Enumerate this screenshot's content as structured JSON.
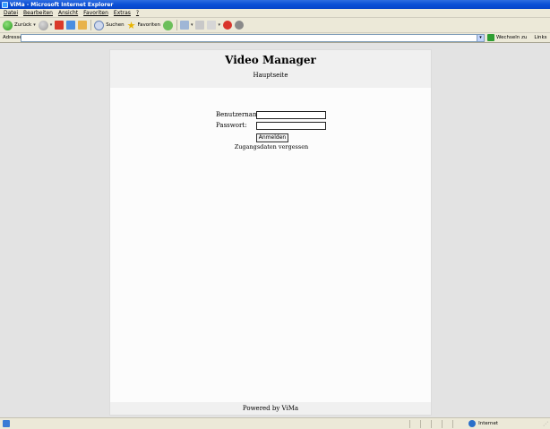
{
  "window": {
    "title": "ViMa - Microsoft Internet Explorer"
  },
  "menu": [
    "Datei",
    "Bearbeiten",
    "Ansicht",
    "Favoriten",
    "Extras",
    "?"
  ],
  "toolbar": {
    "back_label": "Zurück",
    "search_label": "Suchen",
    "favorites_label": "Favoriten"
  },
  "address": {
    "label": "Adresse",
    "value": "",
    "go_label": "Wechseln zu",
    "links_label": "Links"
  },
  "page": {
    "title": "Video Manager",
    "nav_home": "Hauptseite",
    "username_label": "Benutzername:",
    "password_label": "Passwort:",
    "username_value": "",
    "password_value": "",
    "login_button": "Anmelden",
    "forgot_link": "Zugangsdaten vergessen",
    "footer": "Powered by ViMa"
  },
  "status": {
    "zone": "Internet"
  }
}
